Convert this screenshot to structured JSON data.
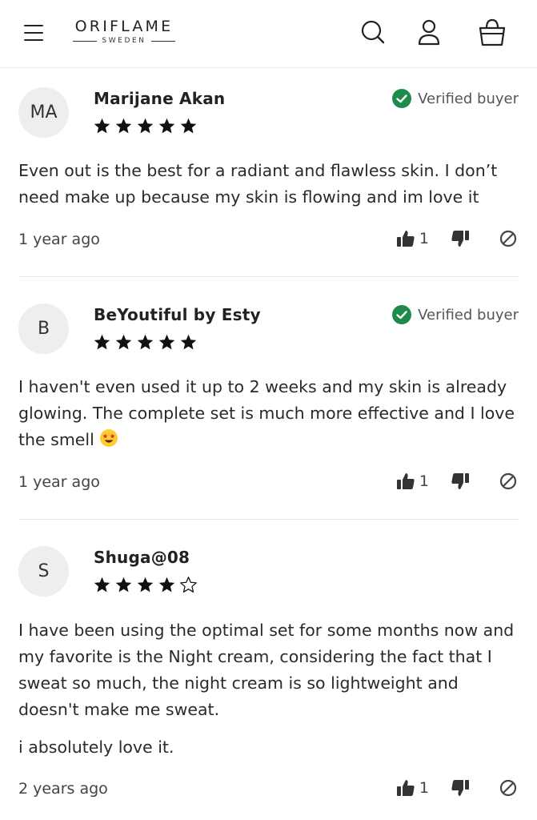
{
  "header": {
    "menu_icon": "hamburger-menu-icon",
    "brand": "ORIFLAME",
    "brand_sub": "SWEDEN",
    "search_icon": "search-icon",
    "account_icon": "user-icon",
    "cart_icon": "shopping-bag-icon"
  },
  "colors": {
    "verified_green": "#1e8a4c",
    "star": "#111111",
    "avatar_bg": "#eeeeee"
  },
  "reviews": [
    {
      "initials": "MA",
      "name": "Marijane Akan",
      "rating": 5,
      "verified_label": "Verified buyer",
      "paragraphs": [
        "Even out is the best for a radiant and flawless skin. I don’t need make up because my skin is flowing and im love it"
      ],
      "time": "1 year ago",
      "likes": "1"
    },
    {
      "initials": "B",
      "name": "BeYoutiful by Esty",
      "rating": 5,
      "verified_label": "Verified buyer",
      "paragraphs": [
        "I haven't even used it up to 2 weeks and my skin is already glowing. The complete set is much more effective and I love the smell"
      ],
      "emoji": "star-struck-emoji",
      "time": "1 year ago",
      "likes": "1"
    },
    {
      "initials": "S",
      "name": "Shuga@08",
      "rating": 4,
      "paragraphs": [
        "I have been using the optimal set for some months now and my favorite is the Night cream, considering the fact that I sweat so much, the night cream is so lightweight and doesn't make me sweat.",
        "i absolutely love it."
      ],
      "time": "2 years ago",
      "likes": "1"
    }
  ]
}
